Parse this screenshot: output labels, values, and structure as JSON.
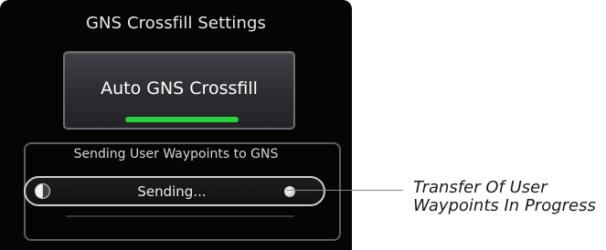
{
  "screen": {
    "title": "GNS Crossfill Settings",
    "auto_button": {
      "label": "Auto GNS Crossfill",
      "indicator_state": "on",
      "indicator_color": "#29d13b"
    },
    "transfer_group": {
      "label": "Sending User Waypoints to GNS",
      "status_text": "Sending...",
      "status_icon": "half-circle-spinner-icon"
    }
  },
  "callout": {
    "line1": "Transfer Of User",
    "line2": "Waypoints In Progress"
  }
}
